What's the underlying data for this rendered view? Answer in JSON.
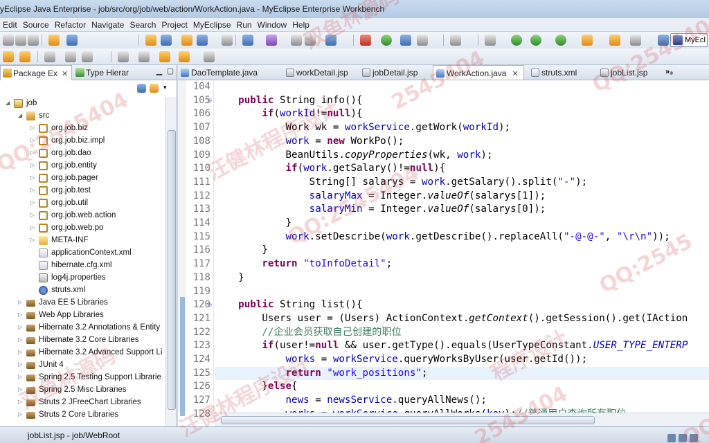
{
  "window": {
    "title": "yEclipse Java Enterprise - job/src/org/job/web/action/WorkAction.java - MyEclipse Enterprise Workbench"
  },
  "menu": [
    "Edit",
    "Source",
    "Refactor",
    "Navigate",
    "Search",
    "Project",
    "MyEclipse",
    "Run",
    "Window",
    "Help"
  ],
  "perspective": {
    "label": "MyEcl"
  },
  "left_panel": {
    "tabs": [
      {
        "label": "Package Ex",
        "active": true
      },
      {
        "label": "Type Hierar",
        "active": false
      }
    ],
    "tree": [
      {
        "label": "job",
        "depth": 0,
        "icon": "project-icon",
        "expanded": true
      },
      {
        "label": "src",
        "depth": 1,
        "icon": "source-folder-icon",
        "expanded": true
      },
      {
        "label": "org.job.biz",
        "depth": 2,
        "icon": "package-icon"
      },
      {
        "label": "org.job.biz.impl",
        "depth": 2,
        "icon": "package-icon"
      },
      {
        "label": "org.job.dao",
        "depth": 2,
        "icon": "package-icon"
      },
      {
        "label": "org.job.entity",
        "depth": 2,
        "icon": "package-icon"
      },
      {
        "label": "org.job.pager",
        "depth": 2,
        "icon": "package-icon"
      },
      {
        "label": "org.job.test",
        "depth": 2,
        "icon": "package-icon"
      },
      {
        "label": "org.job.util",
        "depth": 2,
        "icon": "package-icon"
      },
      {
        "label": "org.job.web.action",
        "depth": 2,
        "icon": "package-icon"
      },
      {
        "label": "org.job.web.po",
        "depth": 2,
        "icon": "package-icon"
      },
      {
        "label": "META-INF",
        "depth": 2,
        "icon": "folder-icon"
      },
      {
        "label": "applicationContext.xml",
        "depth": 2,
        "icon": "xml-file-icon",
        "noarrow": true
      },
      {
        "label": "hibernate.cfg.xml",
        "depth": 2,
        "icon": "xml-file-icon",
        "noarrow": true
      },
      {
        "label": "log4j.properties",
        "depth": 2,
        "icon": "properties-file-icon",
        "noarrow": true
      },
      {
        "label": "struts.xml",
        "depth": 2,
        "icon": "struts-config-icon",
        "noarrow": true
      },
      {
        "label": "Java EE 5 Libraries",
        "depth": 1,
        "icon": "library-icon"
      },
      {
        "label": "Web App Libraries",
        "depth": 1,
        "icon": "library-icon"
      },
      {
        "label": "Hibernate 3.2 Annotations & Entity",
        "depth": 1,
        "icon": "library-icon"
      },
      {
        "label": "Hibernate 3.2 Core Libraries",
        "depth": 1,
        "icon": "library-icon"
      },
      {
        "label": "Hibernate 3.2 Advanced Support Li",
        "depth": 1,
        "icon": "library-icon"
      },
      {
        "label": "JUnit 4",
        "depth": 1,
        "icon": "library-icon"
      },
      {
        "label": "Spring 2.5 Testing Support Librarie",
        "depth": 1,
        "icon": "library-icon"
      },
      {
        "label": "Spring 2.5 Misc Libraries",
        "depth": 1,
        "icon": "library-icon"
      },
      {
        "label": "Struts 2 JFreeChart Libraries",
        "depth": 1,
        "icon": "library-icon"
      },
      {
        "label": "Struts 2 Core Libraries",
        "depth": 1,
        "icon": "library-icon"
      }
    ]
  },
  "editor": {
    "tabs": [
      {
        "label": "DaoTemplate.java",
        "icon": "java-file-icon",
        "active": false
      },
      {
        "label": "workDetail.jsp",
        "icon": "jsp-file-icon",
        "active": false
      },
      {
        "label": "jobDetail.jsp",
        "icon": "jsp-file-icon",
        "active": false
      },
      {
        "label": "WorkAction.java",
        "icon": "java-file-icon",
        "active": true
      },
      {
        "label": "struts.xml",
        "icon": "xml-file-icon",
        "active": false
      },
      {
        "label": "jobList.jsp",
        "icon": "jsp-file-icon",
        "active": false
      }
    ],
    "more_tabs": "»₃",
    "lines": [
      {
        "n": "104",
        "html": ""
      },
      {
        "n": "105",
        "fold": true,
        "html": "    <span class='k'>public</span> String info(){"
      },
      {
        "n": "106",
        "html": "        <span class='k'>if</span>(<span class='f'>workId</span>!=<span class='k'>null</span>){"
      },
      {
        "n": "107",
        "html": "            Work wk = <span class='f'>workService</span>.getWork(<span class='f'>workId</span>);"
      },
      {
        "n": "108",
        "html": "            <span class='f'>work</span> = <span class='k'>new</span> WorkPo();"
      },
      {
        "n": "109",
        "html": "            BeanUtils.<span class='i'>copyProperties</span>(wk, <span class='f'>work</span>);"
      },
      {
        "n": "110",
        "html": "            <span class='k'>if</span>(<span class='f'>work</span>.getSalary()!=<span class='k'>null</span>){"
      },
      {
        "n": "111",
        "html": "                String[] salarys = <span class='f'>work</span>.getSalary().split(<span class='s'>\"-\"</span>);"
      },
      {
        "n": "112",
        "html": "                <span class='f'>salaryMax</span> = Integer.<span class='i'>valueOf</span>(salarys[1]);"
      },
      {
        "n": "113",
        "html": "                <span class='f'>salaryMin</span> = Integer.<span class='i'>valueOf</span>(salarys[0]);"
      },
      {
        "n": "114",
        "html": "            }"
      },
      {
        "n": "115",
        "html": "            <span class='f'>work</span>.setDescribe(<span class='f'>work</span>.getDescribe().replaceAll(<span class='s'>\"-@-@-\"</span>, <span class='s'>\"\\r\\n\"</span>));"
      },
      {
        "n": "116",
        "html": "        }"
      },
      {
        "n": "117",
        "html": "        <span class='k'>return</span> <span class='s'>\"toInfoDetail\"</span>;"
      },
      {
        "n": "118",
        "html": "    }"
      },
      {
        "n": "119",
        "html": ""
      },
      {
        "n": "120",
        "fold": true,
        "html": "    <span class='k'>public</span> String list(){"
      },
      {
        "n": "121",
        "html": "        Users user = (Users) ActionContext.<span class='i'>getContext</span>().getSession().get(IAction"
      },
      {
        "n": "122",
        "html": "        <span class='c'>//企业会员获取自己创建的职位</span>"
      },
      {
        "n": "123",
        "html": "        <span class='k'>if</span>(user!=<span class='k'>null</span> &amp;&amp; user.getType().equals(UserTypeConstant.<span class='cst'>USER_TYPE_ENTERP</span>"
      },
      {
        "n": "124",
        "html": "            <span class='f'>works</span> = <span class='f'>workService</span>.queryWorksByUser(user.getId());"
      },
      {
        "n": "125",
        "cur": true,
        "html": "            <span class='k'>return</span> <span class='s'>\"work_positions\"</span>;"
      },
      {
        "n": "126",
        "html": "        }<span class='k'>else</span>{"
      },
      {
        "n": "127",
        "html": "            <span class='f'>news</span> = <span class='f'>newsService</span>.queryAllNews();"
      },
      {
        "n": "128",
        "html": "            <span class='f'>works</span> = <span class='f'>workService</span>.queryAllWorks(<span class='f'>key</span>);<span class='c'>//普通用户查询所有职位</span>"
      }
    ]
  },
  "status": {
    "text": "jobList.jsp - job/WebRoot"
  },
  "watermark": [
    "QQ:2545404",
    "双鱼林源码出品",
    "汪健林程序设计",
    "2545404",
    "QQ:2545404",
    "双鱼林源码",
    "汪健林程序设计",
    "QQ:2545404",
    "2545404",
    "QQ:2545",
    "程序设计",
    "QQ:25"
  ]
}
